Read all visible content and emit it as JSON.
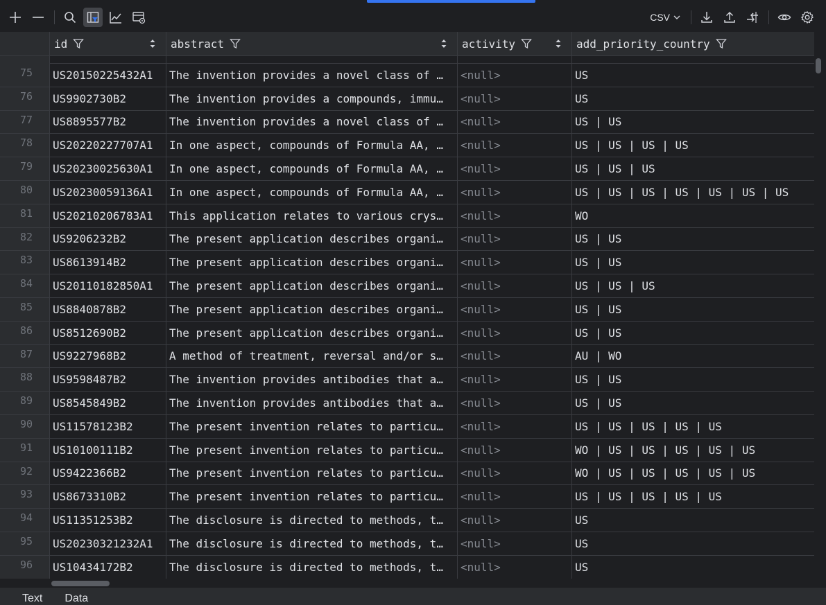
{
  "toolbar": {
    "icons": [
      "plus-icon",
      "minus-icon",
      "search-icon",
      "filter-view-icon",
      "chart-icon",
      "layout-settings-icon"
    ],
    "format_label": "CSV",
    "right_icons": [
      "download-icon",
      "upload-icon",
      "compare-icon",
      "eye-icon",
      "gear-icon"
    ]
  },
  "columns": {
    "id": "id",
    "abstract": "abstract",
    "activity": "activity",
    "add_priority_country": "add_priority_country"
  },
  "rows": [
    {
      "n": "75",
      "id": "US20150225432A1",
      "abstract": "The invention provides a novel class of …",
      "activity": "<null>",
      "country": "US"
    },
    {
      "n": "76",
      "id": "US9902730B2",
      "abstract": "The invention provides a compounds, immu…",
      "activity": "<null>",
      "country": "US"
    },
    {
      "n": "77",
      "id": "US8895577B2",
      "abstract": "The invention provides a novel class of …",
      "activity": "<null>",
      "country": "US | US"
    },
    {
      "n": "78",
      "id": "US20220227707A1",
      "abstract": "In one aspect, compounds of Formula AA, …",
      "activity": "<null>",
      "country": "US | US | US | US"
    },
    {
      "n": "79",
      "id": "US20230025630A1",
      "abstract": "In one aspect, compounds of Formula AA, …",
      "activity": "<null>",
      "country": "US | US | US"
    },
    {
      "n": "80",
      "id": "US20230059136A1",
      "abstract": "In one aspect, compounds of Formula AA, …",
      "activity": "<null>",
      "country": "US | US | US | US | US | US | US"
    },
    {
      "n": "81",
      "id": "US20210206783A1",
      "abstract": "This application relates to various crys…",
      "activity": "<null>",
      "country": "WO"
    },
    {
      "n": "82",
      "id": "US9206232B2",
      "abstract": "The present application describes organi…",
      "activity": "<null>",
      "country": "US | US"
    },
    {
      "n": "83",
      "id": "US8613914B2",
      "abstract": "The present application describes organi…",
      "activity": "<null>",
      "country": "US | US"
    },
    {
      "n": "84",
      "id": "US20110182850A1",
      "abstract": "The present application describes organi…",
      "activity": "<null>",
      "country": "US | US | US"
    },
    {
      "n": "85",
      "id": "US8840878B2",
      "abstract": "The present application describes organi…",
      "activity": "<null>",
      "country": "US | US"
    },
    {
      "n": "86",
      "id": "US8512690B2",
      "abstract": "The present application describes organi…",
      "activity": "<null>",
      "country": "US | US"
    },
    {
      "n": "87",
      "id": "US9227968B2",
      "abstract": "A method of treatment, reversal and/or s…",
      "activity": "<null>",
      "country": "AU | WO"
    },
    {
      "n": "88",
      "id": "US9598487B2",
      "abstract": "The invention provides antibodies that a…",
      "activity": "<null>",
      "country": "US | US"
    },
    {
      "n": "89",
      "id": "US8545849B2",
      "abstract": "The invention provides antibodies that a…",
      "activity": "<null>",
      "country": "US | US"
    },
    {
      "n": "90",
      "id": "US11578123B2",
      "abstract": "The present invention relates to particu…",
      "activity": "<null>",
      "country": "US | US | US | US | US"
    },
    {
      "n": "91",
      "id": "US10100111B2",
      "abstract": "The present invention relates to particu…",
      "activity": "<null>",
      "country": "WO | US | US | US | US | US"
    },
    {
      "n": "92",
      "id": "US9422366B2",
      "abstract": "The present invention relates to particu…",
      "activity": "<null>",
      "country": "WO | US | US | US | US | US"
    },
    {
      "n": "93",
      "id": "US8673310B2",
      "abstract": "The present invention relates to particu…",
      "activity": "<null>",
      "country": "US | US | US | US | US"
    },
    {
      "n": "94",
      "id": "US11351253B2",
      "abstract": "The disclosure is directed to methods, t…",
      "activity": "<null>",
      "country": "US"
    },
    {
      "n": "95",
      "id": "US20230321232A1",
      "abstract": "The disclosure is directed to methods, t…",
      "activity": "<null>",
      "country": "US"
    },
    {
      "n": "96",
      "id": "US10434172B2",
      "abstract": "The disclosure is directed to methods, t…",
      "activity": "<null>",
      "country": "US"
    }
  ],
  "bottom_tabs": [
    "Text",
    "Data"
  ]
}
